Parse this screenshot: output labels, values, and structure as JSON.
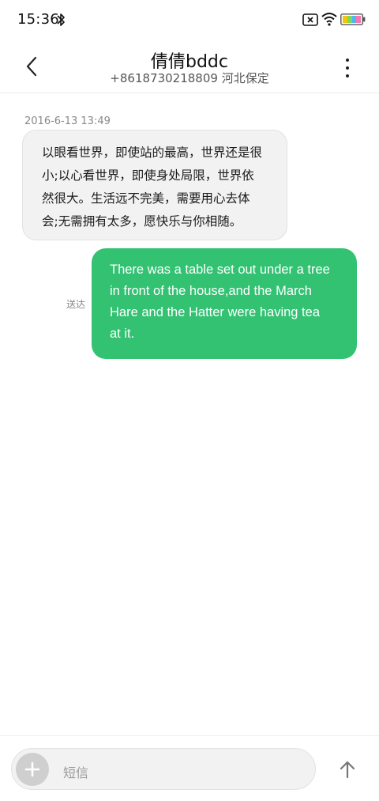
{
  "status_bar": {
    "time": "15:36",
    "icons": [
      "bluetooth-icon",
      "sim-error-icon",
      "wifi-icon",
      "battery-icon"
    ]
  },
  "header": {
    "contact_name": "倩倩bddc",
    "contact_detail": "+8618730218809 河北保定",
    "back_icon": "chevron-left-icon",
    "more_icon": "more-vertical-icon"
  },
  "conversation": {
    "timestamp": "2016-6-13 13:49",
    "incoming": {
      "lines": [
        "以眼看世界，即使站的最高，世界还是很",
        "小;以心看世界，即使身处局限，世界依",
        "然很大。生活远不完美，需要用心去体",
        "会;无需拥有太多，愿快乐与你相随。"
      ]
    },
    "outgoing": {
      "status": "送达",
      "lines": [
        "There was a table set out under a tree",
        "in front of the house,and the March",
        "Hare and the Hatter were having tea",
        "at it."
      ]
    }
  },
  "composer": {
    "placeholder": "短信",
    "attach_icon": "plus-icon",
    "send_icon": "arrow-up-icon"
  },
  "colors": {
    "outgoing_bubble": "#33c172",
    "incoming_bubble": "#f2f2f2",
    "attach_button": "#cfcfcf"
  }
}
